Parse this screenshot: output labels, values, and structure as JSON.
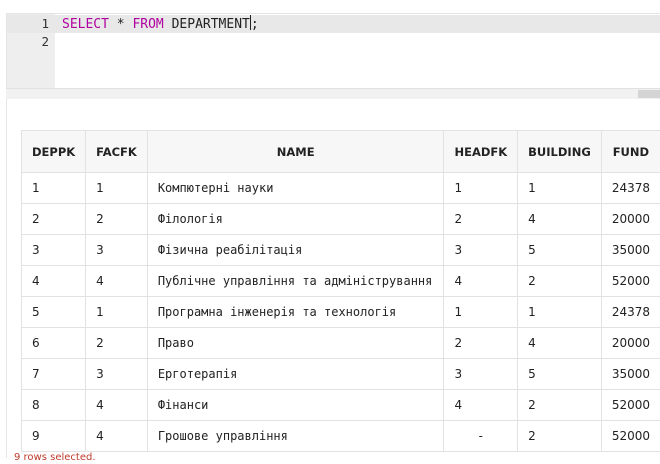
{
  "editor": {
    "lines": [
      {
        "number": "1",
        "kw_select": "SELECT",
        "star": " * ",
        "kw_from": "FROM",
        "rest": " DEPARTMENT",
        "semicolon": ";"
      },
      {
        "number": "2"
      }
    ]
  },
  "results": {
    "columns": [
      "DEPPK",
      "FACFK",
      "NAME",
      "HEADFK",
      "BUILDING",
      "FUND"
    ],
    "rows": [
      [
        "1",
        "1",
        "Компютерні науки",
        "1",
        "1",
        "24378"
      ],
      [
        "2",
        "2",
        "Філологія",
        "2",
        "4",
        "20000"
      ],
      [
        "3",
        "3",
        "Фізична реабілітація",
        "3",
        "5",
        "35000"
      ],
      [
        "4",
        "4",
        "Публічне управління та адміністрування",
        "4",
        "2",
        "52000"
      ],
      [
        "5",
        "1",
        "Програмна інженерія та технологія",
        "1",
        "1",
        "24378"
      ],
      [
        "6",
        "2",
        "Право",
        "2",
        "4",
        "20000"
      ],
      [
        "7",
        "3",
        "Ерготерапія",
        "3",
        "5",
        "35000"
      ],
      [
        "8",
        "4",
        "Фінанси",
        "4",
        "2",
        "52000"
      ],
      [
        "9",
        "4",
        "Грошове управління",
        "-",
        "2",
        "52000"
      ]
    ]
  },
  "status": {
    "text": "9 rows selected."
  },
  "colors": {
    "keyword": "#b000a0",
    "status": "#c0392b"
  }
}
